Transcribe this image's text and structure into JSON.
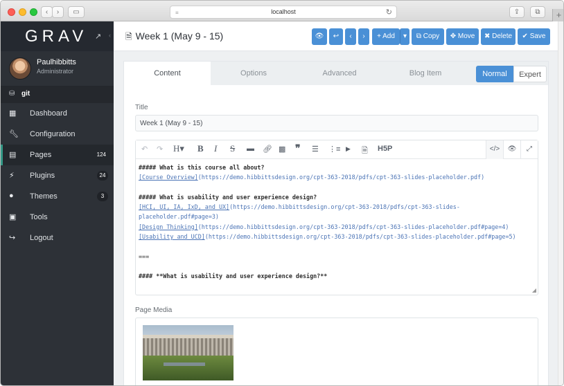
{
  "browser": {
    "url": "localhost"
  },
  "sidebar": {
    "logo": "GRAV",
    "user": {
      "name": "Paulhibbitts",
      "role": "Administrator"
    },
    "git_label": "git",
    "items": [
      {
        "label": "Dashboard",
        "icon": "grid-icon",
        "badge": ""
      },
      {
        "label": "Configuration",
        "icon": "wrench-icon",
        "badge": ""
      },
      {
        "label": "Pages",
        "icon": "file-icon",
        "badge": "124"
      },
      {
        "label": "Plugins",
        "icon": "plug-icon",
        "badge": "24"
      },
      {
        "label": "Themes",
        "icon": "drop-icon",
        "badge": "3"
      },
      {
        "label": "Tools",
        "icon": "briefcase-icon",
        "badge": ""
      },
      {
        "label": "Logout",
        "icon": "logout-icon",
        "badge": ""
      }
    ]
  },
  "header": {
    "title": "Week 1 (May 9 - 15)",
    "buttons": {
      "add": "Add",
      "copy": "Copy",
      "move": "Move",
      "delete": "Delete",
      "save": "Save"
    }
  },
  "tabs": [
    "Content",
    "Options",
    "Advanced",
    "Blog Item"
  ],
  "modes": {
    "normal": "Normal",
    "expert": "Expert"
  },
  "form": {
    "title_label": "Title",
    "title_value": "Week 1 (May 9 - 15)",
    "media_label": "Page Media"
  },
  "editor": {
    "h5p_label": "H5P",
    "lines": {
      "l1": "##### What is this course all about?",
      "l2_link": "[Course Overview]",
      "l2_url": "(https://demo.hibbittsdesign.org/cpt-363-2018/pdfs/cpt-363-slides-placeholder.pdf)",
      "l4": "##### What is usability and user experience design?",
      "l5_link": "[HCI, UI, IA, IxD, and UX]",
      "l5_url": "(https://demo.hibbittsdesign.org/cpt-363-2018/pdfs/cpt-363-slides-",
      "l6_url": "placeholder.pdf#page=3)",
      "l7_link": "[Design Thinking]",
      "l7_url": "(https://demo.hibbittsdesign.org/cpt-363-2018/pdfs/cpt-363-slides-placeholder.pdf#page=4)",
      "l8_link": "[Usability and UCD]",
      "l8_url": "(https://demo.hibbittsdesign.org/cpt-363-2018/pdfs/cpt-363-slides-placeholder.pdf#page=5)",
      "l10": "===",
      "l12": "#### **What is usability and user experience design?**"
    }
  }
}
